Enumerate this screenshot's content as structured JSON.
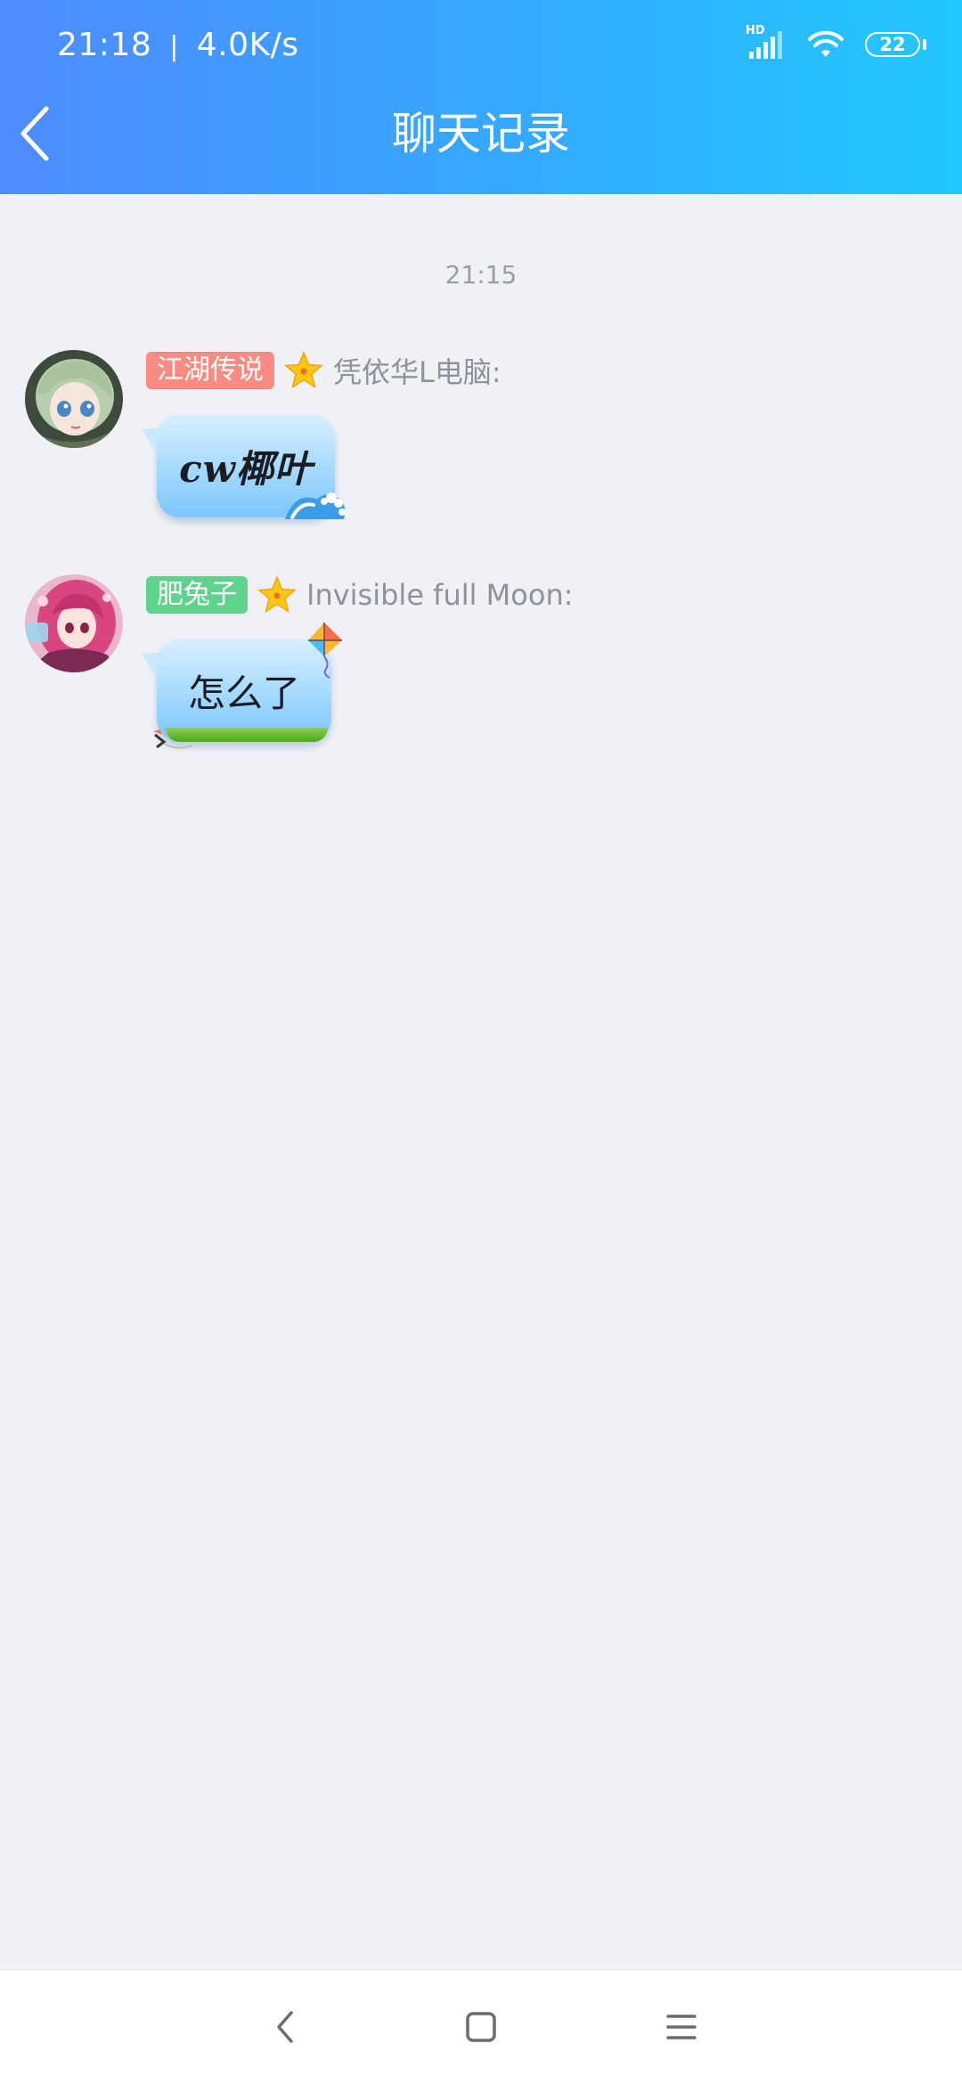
{
  "status_bar": {
    "time": "21:18",
    "separator": "|",
    "net_speed": "4.0K/s",
    "hd_label": "HD",
    "battery": "22"
  },
  "header": {
    "title": "聊天记录",
    "back_icon": "chevron-left-icon"
  },
  "chat": {
    "timestamp": "21:15",
    "messages": [
      {
        "title_badge": "江湖传说",
        "badge_color": "#f98b80",
        "sender": "凭依华L电脑:",
        "text": "cw椰叶",
        "bubble_theme": "ocean-wave"
      },
      {
        "title_badge": "肥兔子",
        "badge_color": "#5fd38c",
        "sender": "Invisible full Moon:",
        "text": "怎么了",
        "bubble_theme": "kite-grass"
      }
    ]
  },
  "nav_bar": {
    "back": "triangle-back-icon",
    "home": "square-home-icon",
    "menu": "hamburger-menu-icon"
  },
  "colors": {
    "header_gradient_start": "#4f8bff",
    "header_gradient_end": "#22c8ff",
    "background": "#f0f1f6"
  }
}
